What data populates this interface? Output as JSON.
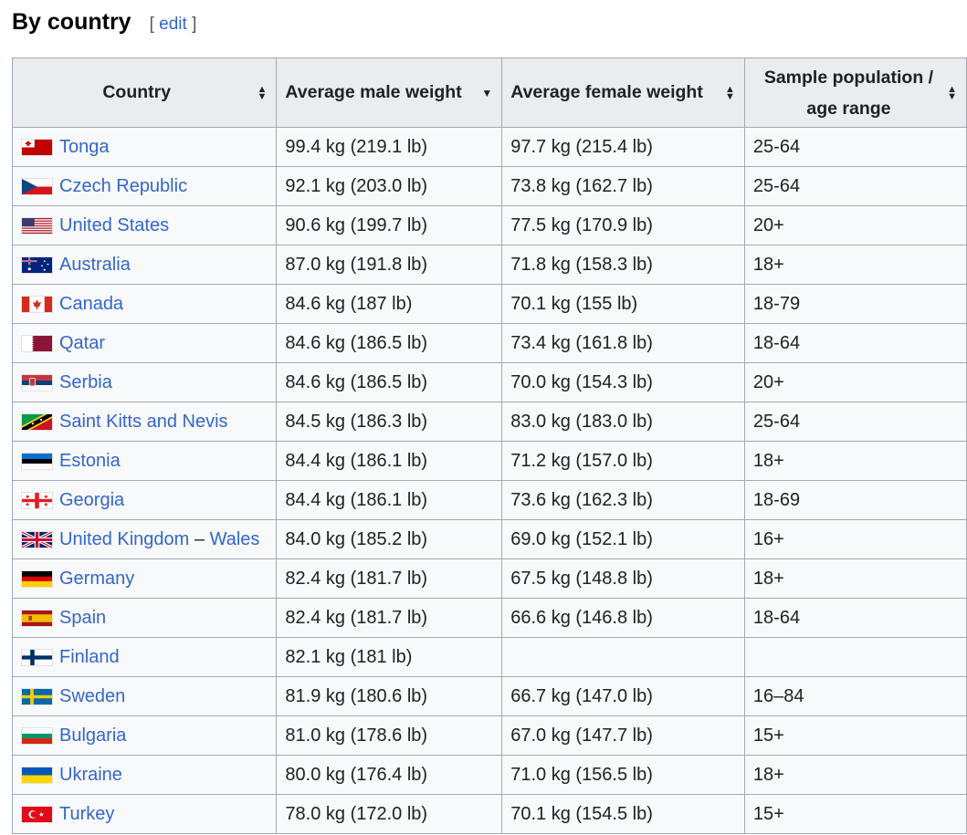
{
  "section": {
    "title": "By country",
    "edit_open": "[ ",
    "edit_label": "edit",
    "edit_close": " ]"
  },
  "table": {
    "headers": {
      "country": "Country",
      "male": "Average male weight",
      "female": "Average female weight",
      "sample": "Sample population / age range"
    },
    "sort_icons": {
      "country": "sort-both",
      "male": "sort-descending",
      "female": "sort-both",
      "sample": "sort-both"
    },
    "rows": [
      {
        "flag": "tonga",
        "country": "Tonga",
        "male": "99.4 kg (219.1 lb)",
        "female": "97.7 kg (215.4 lb)",
        "sample": "25-64"
      },
      {
        "flag": "czech",
        "country": "Czech Republic",
        "male": "92.1 kg (203.0 lb)",
        "female": "73.8 kg (162.7 lb)",
        "sample": "25-64"
      },
      {
        "flag": "usa",
        "country": "United States",
        "male": "90.6 kg (199.7 lb)",
        "female": "77.5 kg (170.9 lb)",
        "sample": "20+"
      },
      {
        "flag": "australia",
        "country": "Australia",
        "male": "87.0 kg (191.8 lb)",
        "female": "71.8 kg (158.3 lb)",
        "sample": "18+"
      },
      {
        "flag": "canada",
        "country": "Canada",
        "male": "84.6 kg (187 lb)",
        "female": "70.1 kg (155 lb)",
        "sample": "18-79"
      },
      {
        "flag": "qatar",
        "country": "Qatar",
        "male": "84.6 kg (186.5 lb)",
        "female": "73.4 kg (161.8 lb)",
        "sample": "18-64"
      },
      {
        "flag": "serbia",
        "country": "Serbia",
        "male": "84.6 kg (186.5 lb)",
        "female": "70.0 kg (154.3 lb)",
        "sample": "20+"
      },
      {
        "flag": "skn",
        "country": "Saint Kitts and Nevis",
        "male": "84.5 kg (186.3 lb)",
        "female": "83.0 kg (183.0 lb)",
        "sample": "25-64"
      },
      {
        "flag": "estonia",
        "country": "Estonia",
        "male": "84.4 kg (186.1 lb)",
        "female": "71.2 kg (157.0 lb)",
        "sample": "18+"
      },
      {
        "flag": "georgia",
        "country": "Georgia",
        "male": "84.4 kg (186.1 lb)",
        "female": "73.6 kg (162.3 lb)",
        "sample": "18-69"
      },
      {
        "flag": "uk",
        "country": "United Kingdom",
        "country_suffix": " – ",
        "country_link2": "Wales",
        "male": "84.0 kg (185.2 lb)",
        "female": "69.0 kg (152.1 lb)",
        "sample": "16+"
      },
      {
        "flag": "germany",
        "country": "Germany",
        "male": "82.4 kg (181.7 lb)",
        "female": "67.5 kg (148.8 lb)",
        "sample": "18+"
      },
      {
        "flag": "spain",
        "country": "Spain",
        "male": "82.4 kg (181.7 lb)",
        "female": "66.6 kg (146.8 lb)",
        "sample": "18-64"
      },
      {
        "flag": "finland",
        "country": "Finland",
        "male": "82.1 kg (181 lb)",
        "female": "",
        "sample": ""
      },
      {
        "flag": "sweden",
        "country": "Sweden",
        "male": "81.9 kg (180.6 lb)",
        "female": "66.7 kg (147.0 lb)",
        "sample": "16–84"
      },
      {
        "flag": "bulgaria",
        "country": "Bulgaria",
        "male": "81.0 kg (178.6 lb)",
        "female": "67.0 kg (147.7 lb)",
        "sample": "15+"
      },
      {
        "flag": "ukraine",
        "country": "Ukraine",
        "male": "80.0 kg (176.4 lb)",
        "female": "71.0 kg (156.5 lb)",
        "sample": "18+"
      },
      {
        "flag": "turkey",
        "country": "Turkey",
        "male": "78.0 kg (172.0 lb)",
        "female": "70.1 kg (154.5 lb)",
        "sample": "15+"
      }
    ]
  },
  "colors": {
    "link": "#3366cc",
    "header_bg": "#eaecf0",
    "cell_bg": "#f8f9fa",
    "border": "#a2a9b1"
  }
}
